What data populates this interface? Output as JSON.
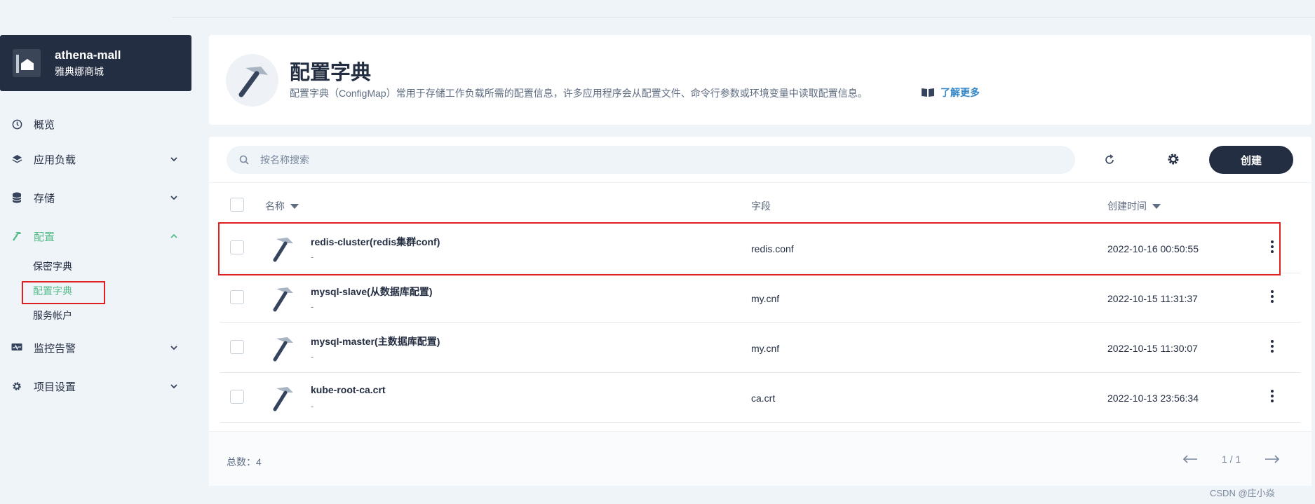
{
  "project": {
    "name": "athena-mall",
    "alias": "雅典娜商城"
  },
  "nav": {
    "overview": "概览",
    "workloads": "应用负载",
    "storage": "存储",
    "config": "配置",
    "config_sub": {
      "secrets": "保密字典",
      "configmaps": "配置字典",
      "service_accounts": "服务帐户"
    },
    "monitoring": "监控告警",
    "project_settings": "项目设置"
  },
  "header": {
    "title": "配置字典",
    "description": "配置字典（ConfigMap）常用于存储工作负载所需的配置信息，许多应用程序会从配置文件、命令行参数或环境变量中读取配置信息。",
    "learn_more": "了解更多"
  },
  "toolbar": {
    "search_placeholder": "按名称搜索",
    "create_label": "创建"
  },
  "table": {
    "columns": {
      "name": "名称",
      "field": "字段",
      "created": "创建时间"
    },
    "rows": [
      {
        "name": "redis-cluster(redis集群conf)",
        "alias": "-",
        "field": "redis.conf",
        "created": "2022-10-16 00:50:55"
      },
      {
        "name": "mysql-slave(从数据库配置)",
        "alias": "-",
        "field": "my.cnf",
        "created": "2022-10-15 11:31:37"
      },
      {
        "name": "mysql-master(主数据库配置)",
        "alias": "-",
        "field": "my.cnf",
        "created": "2022-10-15 11:30:07"
      },
      {
        "name": "kube-root-ca.crt",
        "alias": "-",
        "field": "ca.crt",
        "created": "2022-10-13 23:56:34"
      }
    ]
  },
  "footer": {
    "total": "总数：4",
    "page": "1 / 1"
  },
  "watermark": "CSDN @庄小焱",
  "colors": {
    "accent": "#55bc8a",
    "dark": "#242e42",
    "highlight": "#e02020",
    "link": "#3385c8"
  }
}
